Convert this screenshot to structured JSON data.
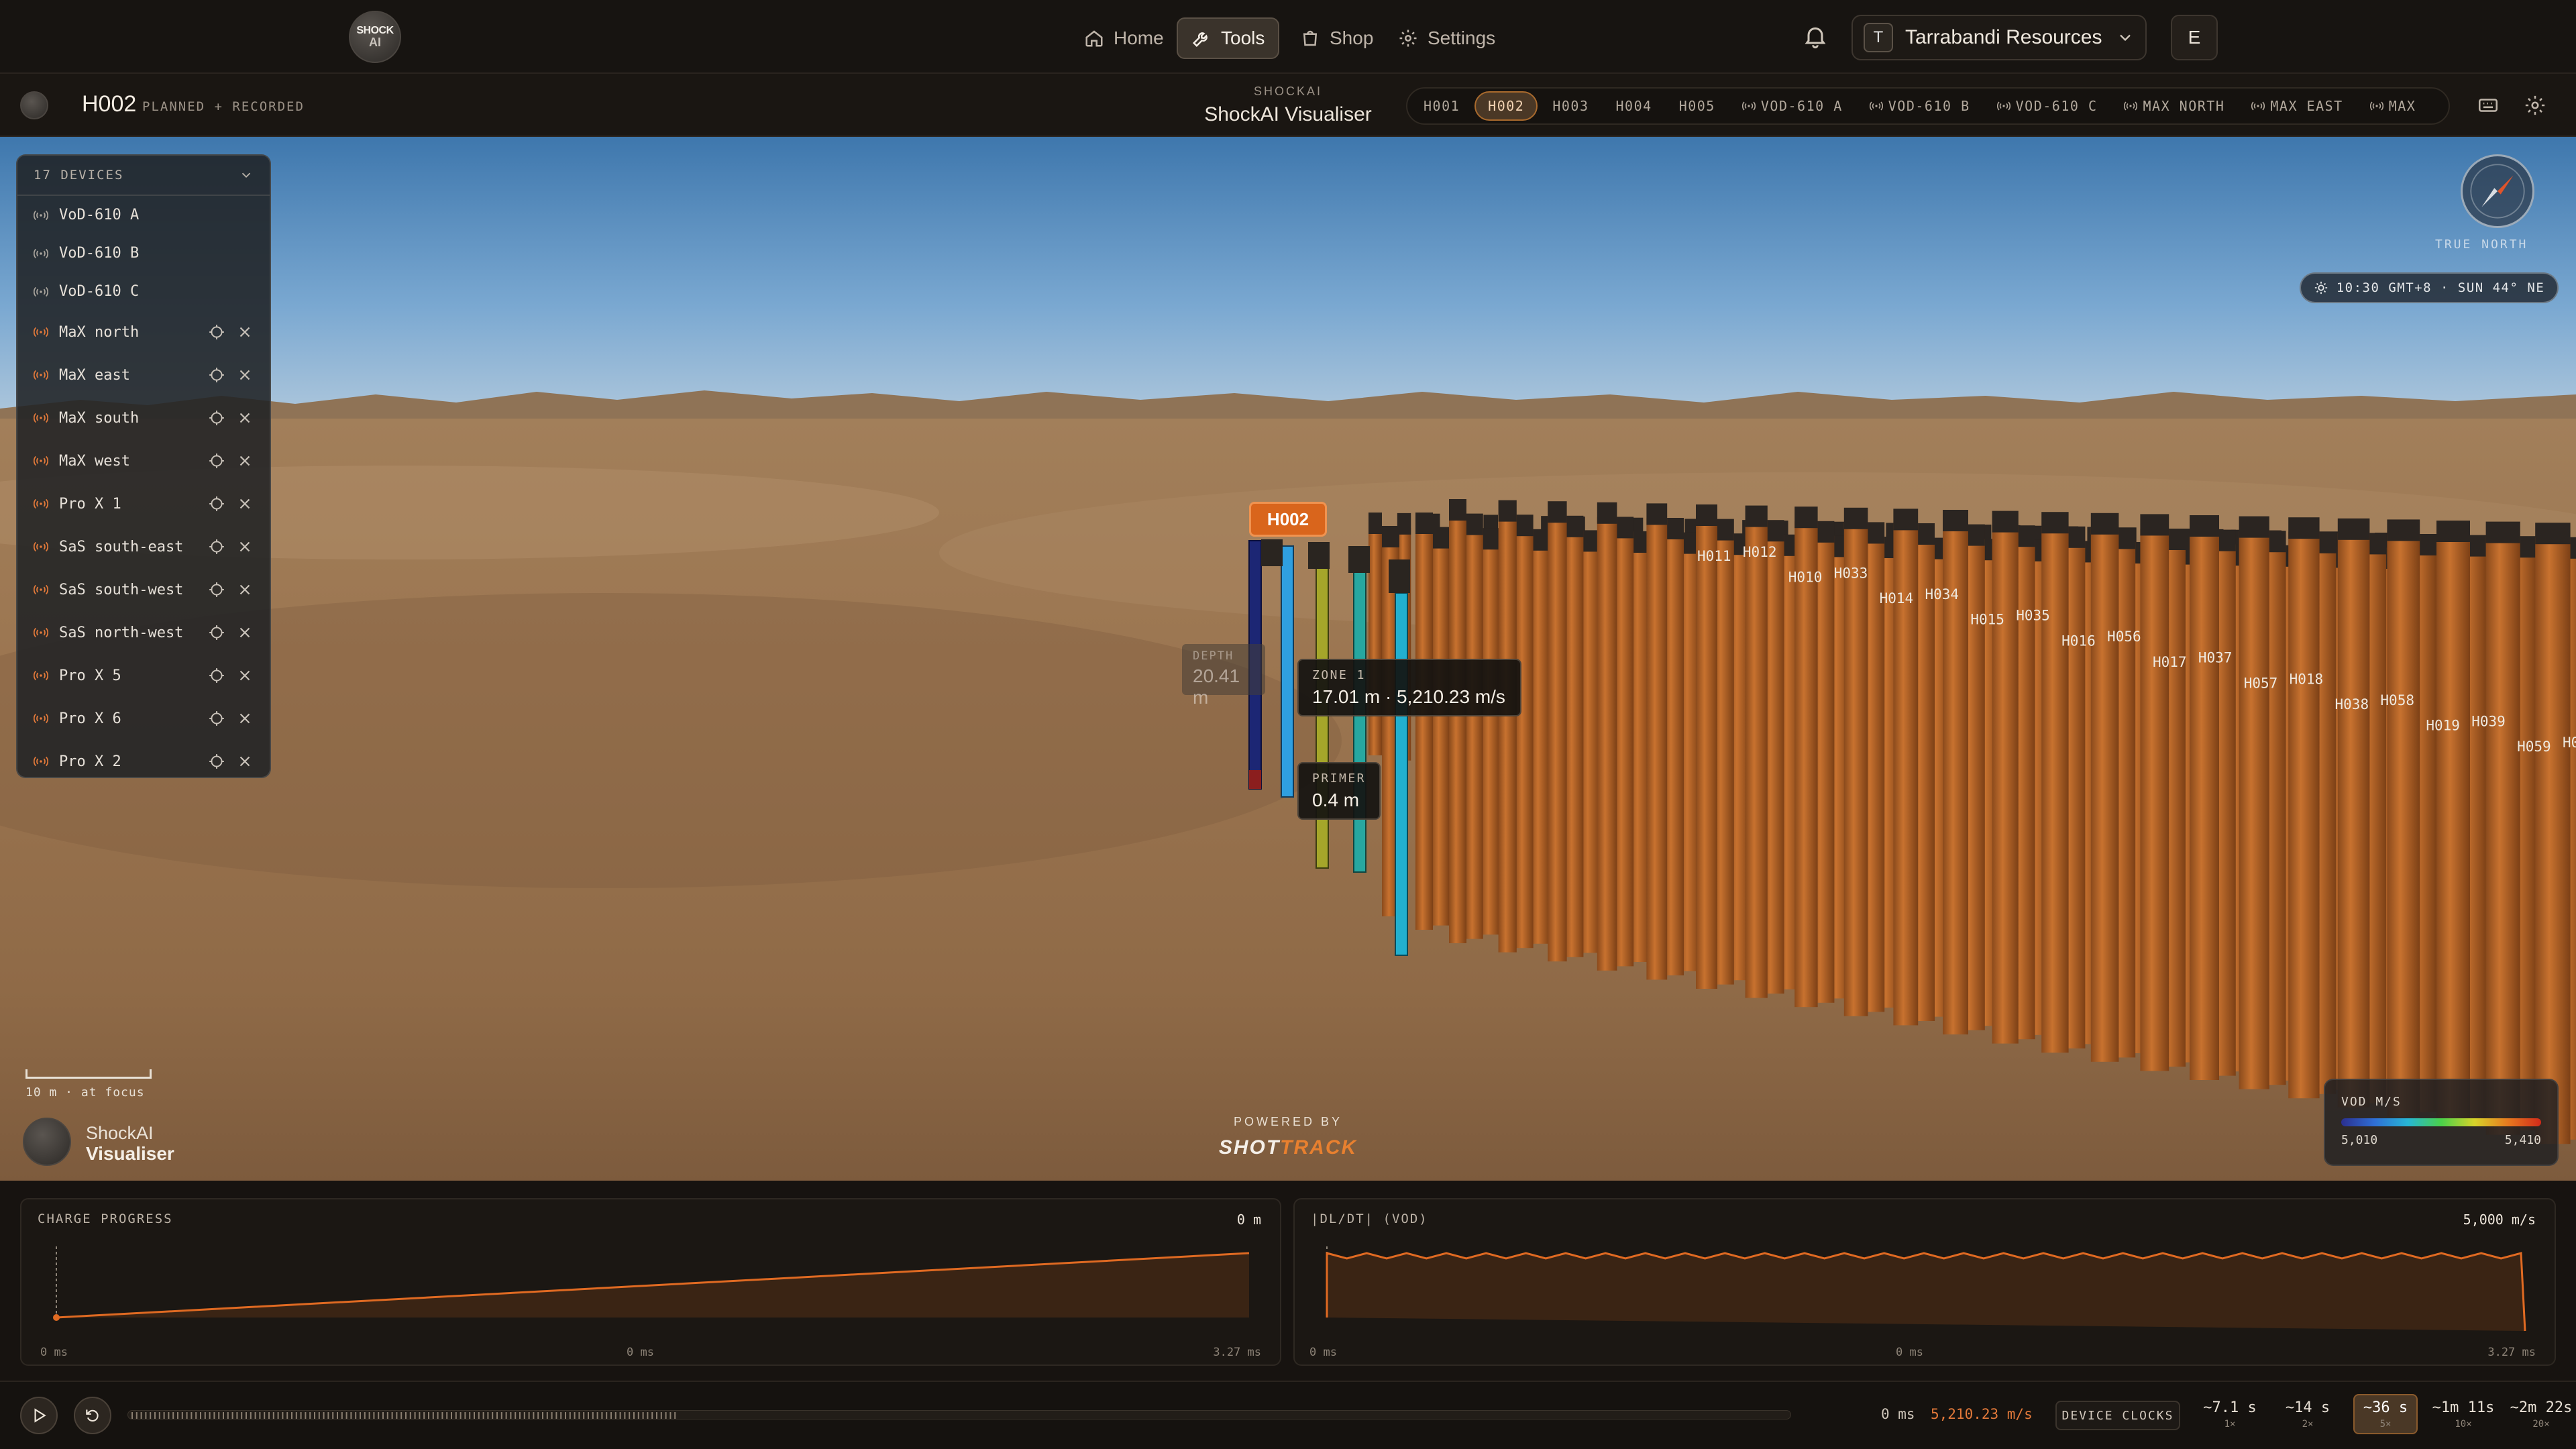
{
  "nav": {
    "logo_top": "SHOCK",
    "logo_bottom": "AI",
    "items": [
      {
        "label": "Home",
        "icon": "home-icon"
      },
      {
        "label": "Tools",
        "icon": "wrench-icon",
        "active": true
      },
      {
        "label": "Shop",
        "icon": "shop-icon"
      },
      {
        "label": "Settings",
        "icon": "gear-icon"
      }
    ],
    "org_initial": "T",
    "org_name": "Tarrabandi Resources",
    "user_initial": "E"
  },
  "subbar": {
    "hole": "H002",
    "hole_status": "PLANNED + RECORDED",
    "app_kicker": "SHOCKAI",
    "app_name": "ShockAI Visualiser",
    "tabs": [
      {
        "label": "H001"
      },
      {
        "label": "H002",
        "active": true
      },
      {
        "label": "H003"
      },
      {
        "label": "H004"
      },
      {
        "label": "H005"
      },
      {
        "label": "VOD-610 A",
        "radio": true
      },
      {
        "label": "VOD-610 B",
        "radio": true
      },
      {
        "label": "VOD-610 C",
        "radio": true
      },
      {
        "label": "MAX NORTH",
        "radio": true
      },
      {
        "label": "MAX EAST",
        "radio": true
      },
      {
        "label": "MAX",
        "radio": true
      }
    ]
  },
  "devices": {
    "title": "17 DEVICES",
    "items": [
      {
        "name": "VoD-610 A",
        "controls": false
      },
      {
        "name": "VoD-610 B",
        "controls": false
      },
      {
        "name": "VoD-610 C",
        "controls": false
      },
      {
        "name": "MaX north",
        "controls": true
      },
      {
        "name": "MaX east",
        "controls": true
      },
      {
        "name": "MaX south",
        "controls": true
      },
      {
        "name": "MaX west",
        "controls": true
      },
      {
        "name": "Pro X 1",
        "controls": true
      },
      {
        "name": "SaS south-east",
        "controls": true
      },
      {
        "name": "SaS south-west",
        "controls": true
      },
      {
        "name": "SaS north-west",
        "controls": true
      },
      {
        "name": "Pro X 5",
        "controls": true
      },
      {
        "name": "Pro X 6",
        "controls": true
      },
      {
        "name": "Pro X 2",
        "controls": true
      }
    ]
  },
  "viewport": {
    "true_north": "TRUE NORTH",
    "sun": "10:30 GMT+8 · SUN 44° NE",
    "hole_label": "H002",
    "depth_label": "DEPTH",
    "depth_value": "20.41 m",
    "zone_label": "ZONE 1",
    "zone_value": "17.01 m · 5,210.23 m/s",
    "primer_label": "PRIMER",
    "primer_value": "0.4 m",
    "hole_tags": [
      "H011",
      "H012",
      "H010",
      "H033",
      "H014",
      "H034",
      "H015",
      "H035",
      "H016",
      "H056",
      "H017",
      "H037",
      "H057",
      "H018",
      "H038",
      "H058",
      "H019",
      "H039",
      "H059",
      "H0"
    ],
    "scale_label": "10 m · at focus",
    "brand_line1": "ShockAI",
    "brand_line2": "Visualiser",
    "powered_by": "POWERED BY",
    "shottrack_a": "SHOT",
    "shottrack_b": "TRACK",
    "legend_title": "VOD M/S",
    "legend_min": "5,010",
    "legend_max": "5,410"
  },
  "charts": {
    "charge": {
      "title": "CHARGE PROGRESS",
      "readout": "0 m",
      "tick_left": "0 ms",
      "tick_mid": "0 ms",
      "tick_right": "3.27 ms"
    },
    "vod": {
      "title": "|DL/DT| (VOD)",
      "readout": "5,000 m/s",
      "tick_left": "0 ms",
      "tick_mid": "0 ms",
      "tick_right": "3.27 ms"
    }
  },
  "transport": {
    "time": "0 ms",
    "vod": "5,210.23 m/s",
    "clocks_label": "DEVICE CLOCKS",
    "speeds": [
      {
        "value": "~7.1 s",
        "mult": "1×"
      },
      {
        "value": "~14 s",
        "mult": "2×"
      },
      {
        "value": "~36 s",
        "mult": "5×",
        "active": true
      },
      {
        "value": "~1m 11s",
        "mult": "10×"
      },
      {
        "value": "~2m 22s",
        "mult": "20×"
      }
    ]
  },
  "colors": {
    "accent": "#d9651c",
    "background": "#14110e",
    "pillar": "#b8652a"
  }
}
